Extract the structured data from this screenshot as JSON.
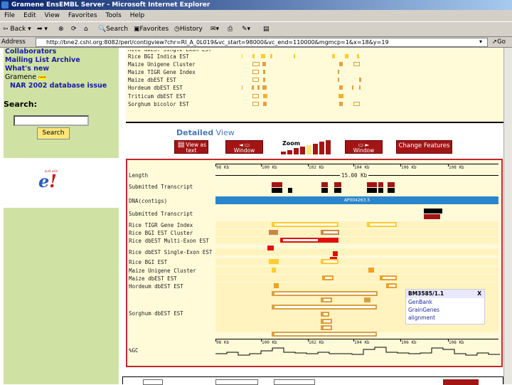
{
  "window": {
    "title": "Gramene EnsEMBL Server - Microsoft Internet Explorer"
  },
  "menu": [
    "File",
    "Edit",
    "View",
    "Favorites",
    "Tools",
    "Help"
  ],
  "toolbar": {
    "back": "Back",
    "search": "Search",
    "favorites": "Favorites",
    "history": "History"
  },
  "address": {
    "label": "Address",
    "url": "http://bne2.cshl.org:8082/perl/contigview?chr=RI_A_0L019&vc_start=98000&vc_end=110000&mgmcp=1&x=18&y=19",
    "go": "Go"
  },
  "sidebar": {
    "links": [
      "Collaborators",
      "Mailing List Archive",
      "What's new"
    ],
    "gramene": "Gramene",
    "new_badge": "new",
    "nar": "NAR 2002 database issue",
    "search_label": "Search:",
    "search_value": "",
    "search_button": "Search",
    "logo_caption": "built with"
  },
  "overview": {
    "tracks": [
      "Rice dbEST Single-Exon EST",
      "Rice BGI Indica EST",
      "Maize Unigene Cluster",
      "Maize TIGR Gene Index",
      "Maize dbEST EST",
      "Hordeum dbEST EST",
      "Triticum dbEST EST",
      "Sorghum bicolor EST"
    ]
  },
  "detailed": {
    "heading_bold": "Detailed",
    "heading_rest": " View",
    "buttons": {
      "view_text": "View as text",
      "window_left": "Window",
      "zoom": "Zoom",
      "window_right": "Window",
      "change_features": "Change Features"
    },
    "zoom_level": 5,
    "ruler": [
      "98 Kb",
      "100 Kb",
      "102 Kb",
      "104 Kb",
      "106 Kb",
      "108 Kb"
    ],
    "length": "15.00 Kb",
    "contig": "AP004263.5",
    "tracks": [
      "Length",
      "Submitted Transcript",
      "DNA(contigs)",
      "Submitted Transcript",
      "Rice TIGR Gene Index",
      "Rice BGI EST Cluster",
      "Rice dbEST Multi-Exon EST",
      "Rice dbEST Single-Exon EST",
      "Rice BGI EST",
      "Maize Unigene Cluster",
      "Maize dbEST EST",
      "Hordeum dbEST EST",
      "Sorghum dbEST EST",
      "%GC"
    ],
    "popup": {
      "title": "BM3585/1.1",
      "close": "X",
      "links": [
        "GenBank",
        "GrainGenes",
        "alignment"
      ]
    }
  },
  "colors": {
    "red": "#a31515",
    "panel": "#fffbd9",
    "sidebar": "#cfe2a3",
    "contig": "#2a86cc"
  }
}
